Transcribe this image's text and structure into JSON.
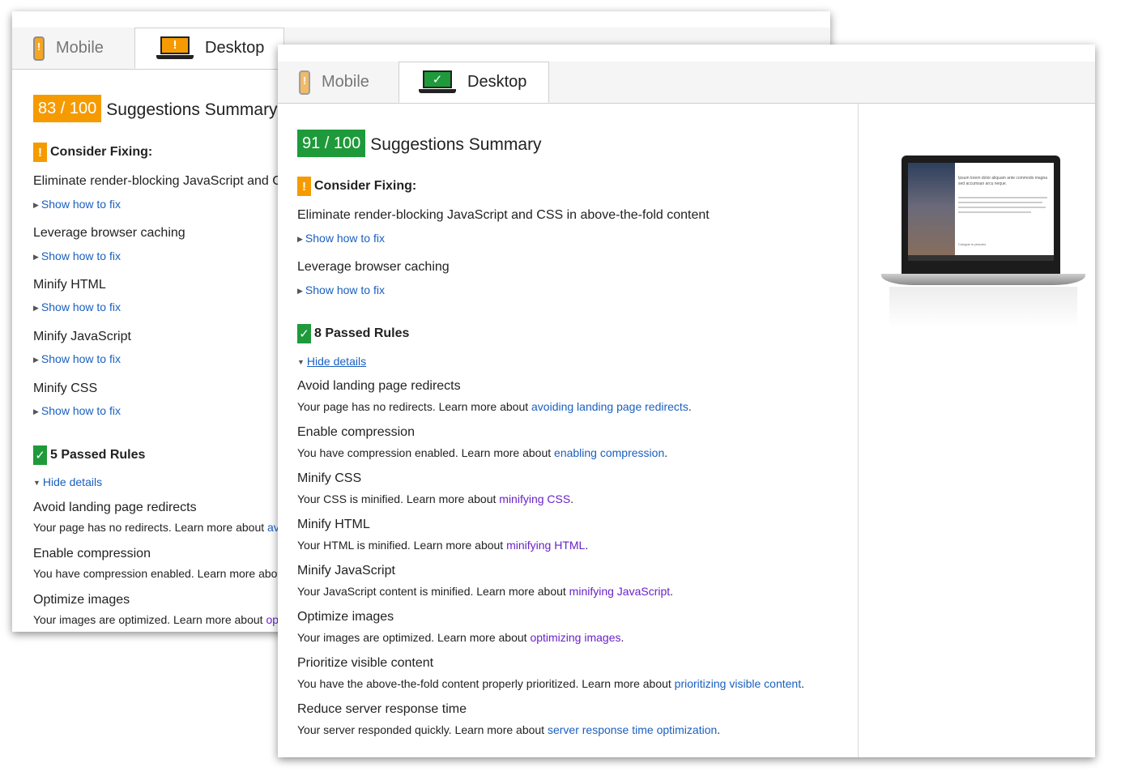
{
  "back": {
    "tabs": {
      "mobile": "Mobile",
      "desktop": "Desktop"
    },
    "score": "83 / 100",
    "summary_title": "Suggestions Summary",
    "consider_header": "Consider Fixing:",
    "rules": [
      "Eliminate render-blocking JavaScript and C",
      "Leverage browser caching",
      "Minify HTML",
      "Minify JavaScript",
      "Minify CSS"
    ],
    "show_fix": "Show how to fix",
    "passed_header": "5 Passed Rules",
    "hide_details": "Hide details",
    "passed": [
      {
        "title": "Avoid landing page redirects",
        "desc": "Your page has no redirects. Learn more about ",
        "link": "av"
      },
      {
        "title": "Enable compression",
        "desc": "You have compression enabled. Learn more abo",
        "link": ""
      },
      {
        "title": "Optimize images",
        "desc": "Your images are optimized. Learn more about ",
        "link": "op"
      }
    ]
  },
  "front": {
    "tabs": {
      "mobile": "Mobile",
      "desktop": "Desktop"
    },
    "score": "91 / 100",
    "summary_title": "Suggestions Summary",
    "consider_header": "Consider Fixing:",
    "rules": [
      "Eliminate render-blocking JavaScript and CSS in above-the-fold content",
      "Leverage browser caching"
    ],
    "show_fix": "Show how to fix",
    "passed_header": "8 Passed Rules",
    "hide_details": "Hide details",
    "passed": [
      {
        "title": "Avoid landing page redirects",
        "desc": "Your page has no redirects. Learn more about ",
        "link": "avoiding landing page redirects",
        "visited": false
      },
      {
        "title": "Enable compression",
        "desc": "You have compression enabled. Learn more about ",
        "link": "enabling compression",
        "visited": false
      },
      {
        "title": "Minify CSS",
        "desc": "Your CSS is minified. Learn more about ",
        "link": "minifying CSS",
        "visited": true
      },
      {
        "title": "Minify HTML",
        "desc": "Your HTML is minified. Learn more about ",
        "link": "minifying HTML",
        "visited": true
      },
      {
        "title": "Minify JavaScript",
        "desc": "Your JavaScript content is minified. Learn more about ",
        "link": "minifying JavaScript",
        "visited": true
      },
      {
        "title": "Optimize images",
        "desc": "Your images are optimized. Learn more about ",
        "link": "optimizing images",
        "visited": true
      },
      {
        "title": "Prioritize visible content",
        "desc": "You have the above-the-fold content properly prioritized. Learn more about ",
        "link": "prioritizing visible content",
        "visited": false
      },
      {
        "title": "Reduce server response time",
        "desc": "Your server responded quickly. Learn more about ",
        "link": "server response time optimization",
        "visited": false
      }
    ],
    "punct": ".",
    "preview_screen": {
      "heading": "Ipsum lorem dolor aliquam ante commodo magna sed accumsan arcu neque.",
      "caption": "Cologne in pictures"
    }
  },
  "colors": {
    "orange": "#f59b00",
    "green": "#1e9a3a",
    "link": "#1a5fc0",
    "visited": "#6a22c9"
  },
  "icons": {
    "mobile": "phone-icon",
    "desktop": "laptop-icon",
    "warning": "exclamation-icon",
    "passed": "checkmark-icon",
    "expand": "triangle-right-icon",
    "collapse": "triangle-down-icon"
  }
}
